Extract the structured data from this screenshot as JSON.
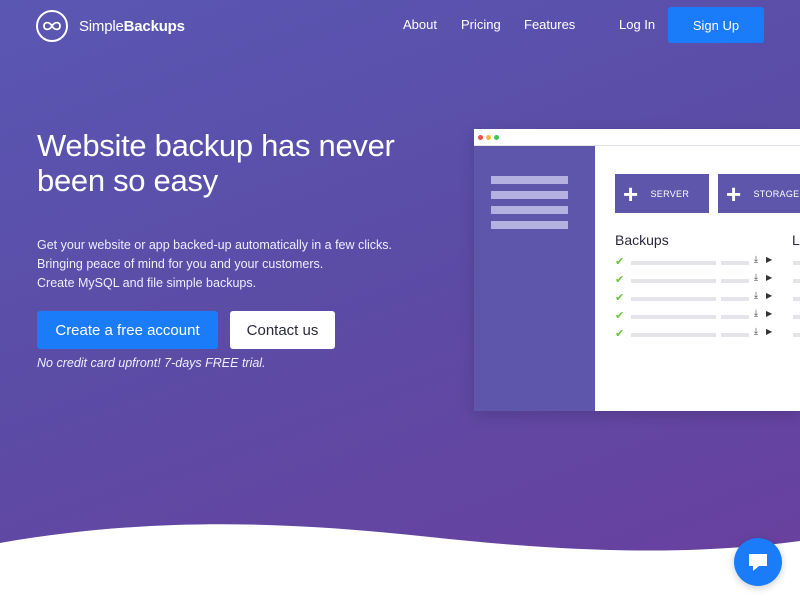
{
  "brand": {
    "name_light": "Simple",
    "name_bold": "Backups"
  },
  "nav": {
    "about": "About",
    "pricing": "Pricing",
    "features": "Features",
    "login": "Log In",
    "signup": "Sign Up"
  },
  "hero": {
    "title": "Website backup has never been so easy",
    "lines": [
      "Get your website or app backed-up automatically in a few clicks.",
      "Bringing peace of mind for you and your customers.",
      "Create MySQL and file simple backups."
    ],
    "cta_primary": "Create a free account",
    "cta_secondary": "Contact us",
    "note": "No credit card upfront! 7-days FREE trial."
  },
  "mock": {
    "btn_server": "SERVER",
    "btn_storage": "STORAGE",
    "heading": "Backups",
    "heading_cut": "L"
  },
  "colors": {
    "primary_button": "#1a7cf9",
    "sidebar": "#5d56aa",
    "check": "#6cc23a"
  },
  "icons": [
    "infinity-icon",
    "plus-icon",
    "check-icon",
    "download-icon",
    "play-icon",
    "chat-icon"
  ]
}
